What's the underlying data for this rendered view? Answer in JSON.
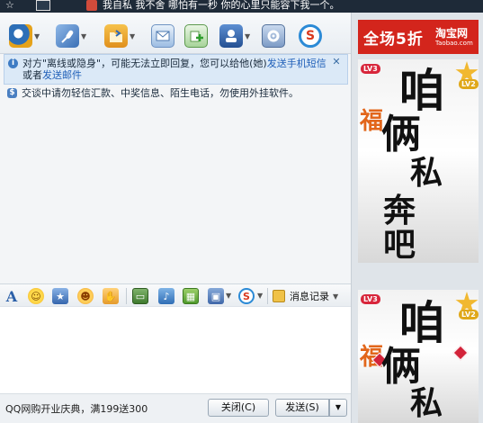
{
  "title_bar": {
    "signature": "我自私 我不舍 哪怕有一秒 你的心里只能容下我一个。"
  },
  "toolbar": {
    "icons": [
      "video-call-icon",
      "voice-call-icon",
      "send-file-icon",
      "sms-icon",
      "add-contact-icon",
      "app-center-icon",
      "settings-icon",
      "tenpay-icon"
    ]
  },
  "notices": {
    "offline_prefix": "对方\"离线或隐身\"，可能无法立即回复，您可以给他(她)",
    "sms_link": "发送手机短信",
    "or_text": "或者",
    "mail_link": "发送邮件",
    "security": "交谈中请勿轻信汇款、中奖信息、陌生电话，勿使用外挂软件。"
  },
  "format_bar": {
    "history_label": "消息记录"
  },
  "bottom_bar": {
    "promo": "QQ网购开业庆典，满199送300",
    "close_label": "关闭(C)",
    "send_label": "发送(S)"
  },
  "ads": {
    "taobao_slogan": "全场5折",
    "taobao_brand": "淘宝网",
    "taobao_domain": "Taobao.com",
    "poster_badge1": "LV3",
    "poster_badge2": "LV2",
    "poster_text": [
      "咱",
      "俩",
      "私",
      "奔",
      "吧"
    ]
  },
  "colors": {
    "ad_red": "#d3251c",
    "link_blue": "#1f5fb8",
    "notice_bg": "#dbe9f7"
  }
}
